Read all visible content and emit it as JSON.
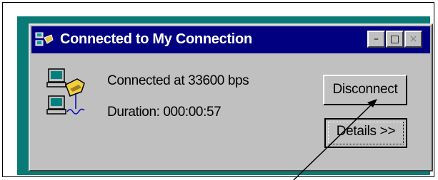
{
  "window": {
    "title": "Connected to My Connection",
    "buttons": {
      "minimize": "–",
      "maximize": "□",
      "close": "×"
    }
  },
  "status": {
    "speed_text": "Connected at 33600 bps",
    "duration_text": "Duration:  000:00:57"
  },
  "actions": {
    "disconnect_label": "Disconnect",
    "details_label": "Details >>"
  },
  "icons": {
    "title": "connection-icon",
    "main": "networked-computers-phone-icon"
  },
  "colors": {
    "desktop": "#0a7a77",
    "titlebar": "#000080",
    "window": "#c0c0c0"
  }
}
